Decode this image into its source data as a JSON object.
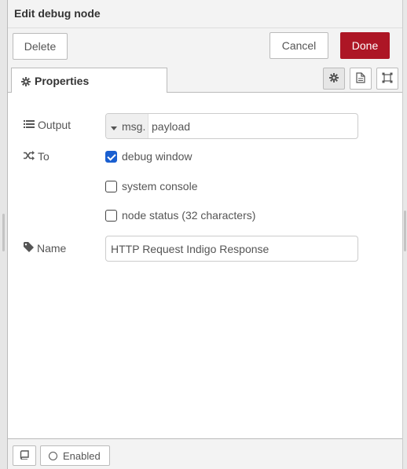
{
  "header": {
    "title": "Edit debug node"
  },
  "toolbar": {
    "delete_label": "Delete",
    "cancel_label": "Cancel",
    "done_label": "Done"
  },
  "tabs": {
    "properties_label": "Properties"
  },
  "form": {
    "output": {
      "label": "Output",
      "type_prefix": "msg.",
      "value": "payload"
    },
    "to": {
      "label": "To",
      "options": [
        {
          "label": "debug window",
          "checked": true
        },
        {
          "label": "system console",
          "checked": false
        },
        {
          "label": "node status (32 characters)",
          "checked": false
        }
      ]
    },
    "name": {
      "label": "Name",
      "value": "HTTP Request Indigo Response"
    }
  },
  "footer": {
    "enabled_label": "Enabled"
  },
  "colors": {
    "done": "#ad1625",
    "checkbox": "#1a5fd0"
  },
  "icons": [
    "gear-icon",
    "document-icon",
    "frame-icon",
    "list-icon",
    "shuffle-icon",
    "tag-icon",
    "book-icon",
    "circle-icon",
    "caret-down-icon"
  ]
}
